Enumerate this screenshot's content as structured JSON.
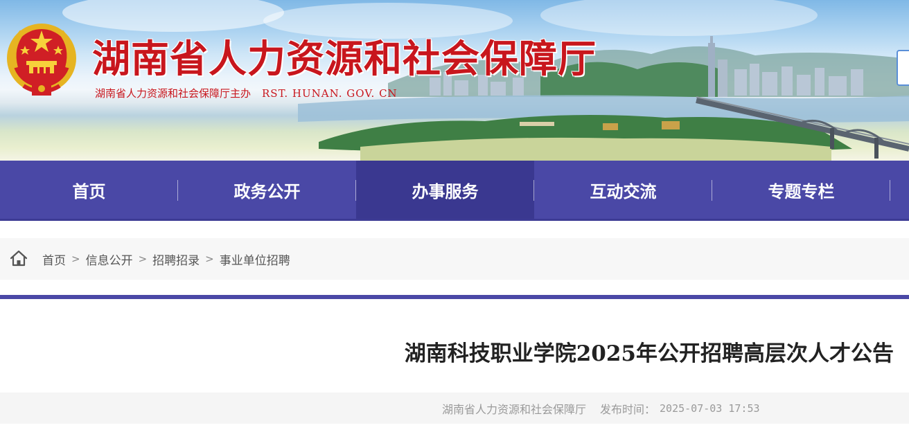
{
  "header": {
    "site_title": "湖南省人力资源和社会保障厅",
    "sponsor": "湖南省人力资源和社会保障厅主办",
    "domain": "RST. HUNAN. GOV. CN",
    "emblem_icon": "national-emblem-icon",
    "title_color": "#c8161d"
  },
  "nav": {
    "items": [
      {
        "label": "首页",
        "active": false
      },
      {
        "label": "政务公开",
        "active": false
      },
      {
        "label": "办事服务",
        "active": true
      },
      {
        "label": "互动交流",
        "active": false
      },
      {
        "label": "专题专栏",
        "active": false
      }
    ],
    "color": "#4a48a6",
    "active_color": "#3a3890"
  },
  "breadcrumb": {
    "home_icon": "home-icon",
    "separator": ">",
    "items": [
      "首页",
      "信息公开",
      "招聘招录",
      "事业单位招聘"
    ]
  },
  "article": {
    "title": "湖南科技职业学院2025年公开招聘高层次人才公告",
    "source": "湖南省人力资源和社会保障厅",
    "published_label": "发布时间：",
    "published_time": "2025-07-03 17:53"
  }
}
